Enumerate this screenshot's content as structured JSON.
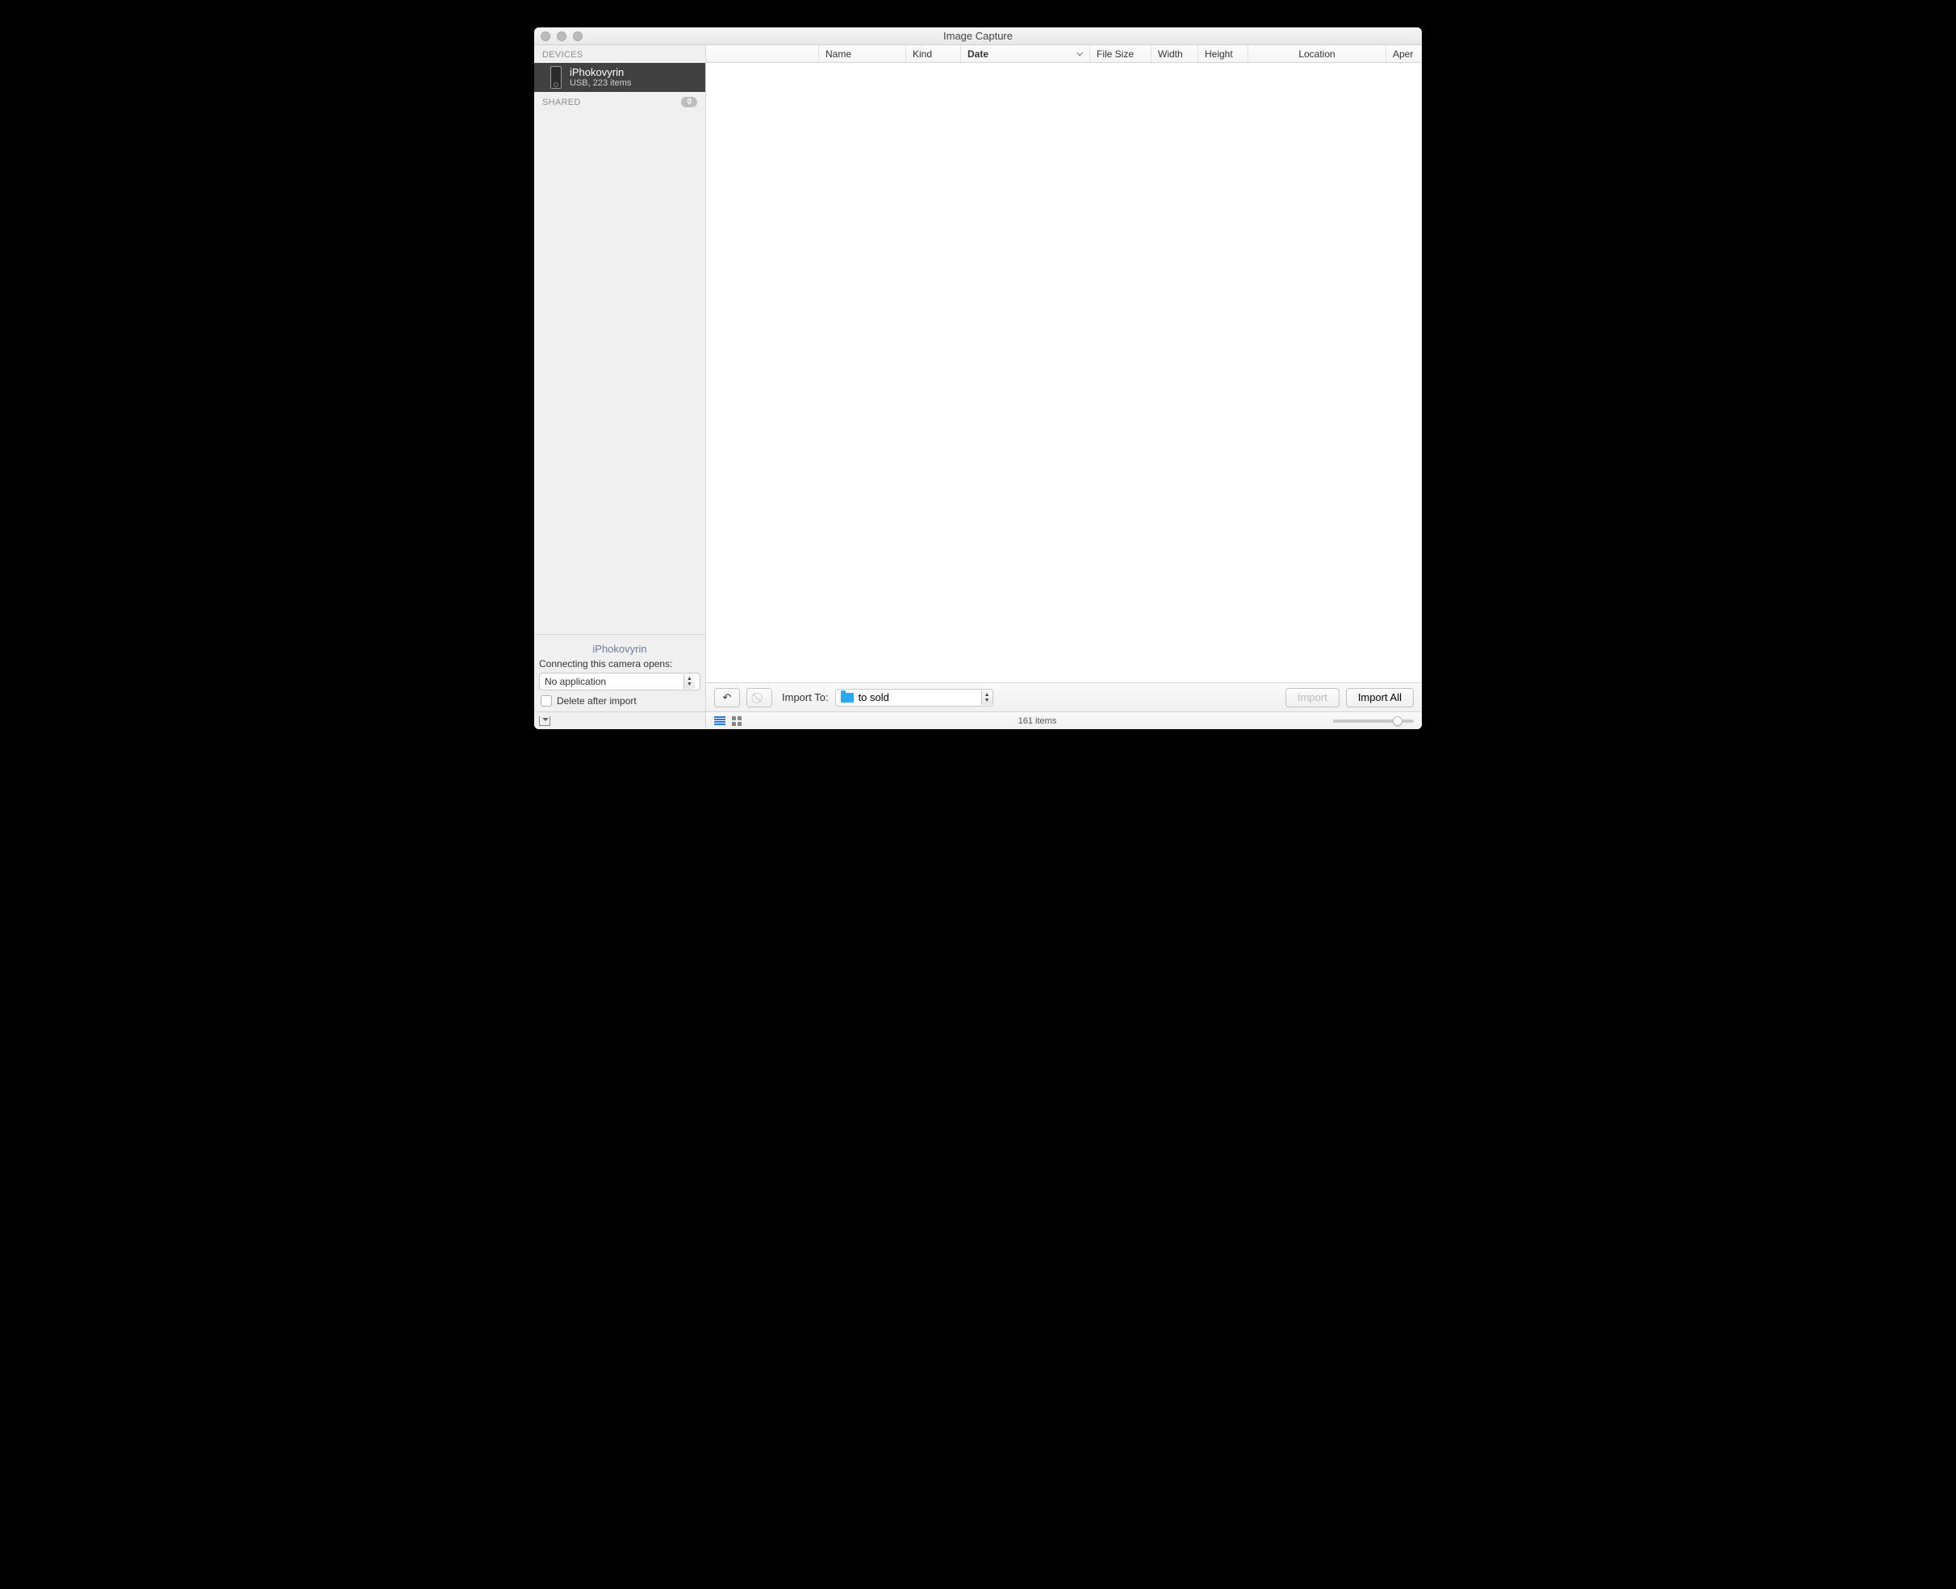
{
  "window": {
    "title": "Image Capture"
  },
  "sidebar": {
    "sections": {
      "devices_label": "DEVICES",
      "shared_label": "SHARED",
      "shared_count": "0"
    },
    "device": {
      "name": "iPhokovyrin",
      "subtitle": "USB, 223 items"
    },
    "bottom": {
      "device_label": "iPhokovyrin",
      "connect_label": "Connecting this camera opens:",
      "app_selected": "No application",
      "delete_label": "Delete after import"
    }
  },
  "columns": {
    "name": "Name",
    "kind": "Kind",
    "date": "Date",
    "file_size": "File Size",
    "width": "Width",
    "height": "Height",
    "location": "Location",
    "aperture": "Aper"
  },
  "toolbar": {
    "import_to_label": "Import To:",
    "destination": "to sold",
    "import_label": "Import",
    "import_all_label": "Import All"
  },
  "status": {
    "items": "161 items"
  }
}
